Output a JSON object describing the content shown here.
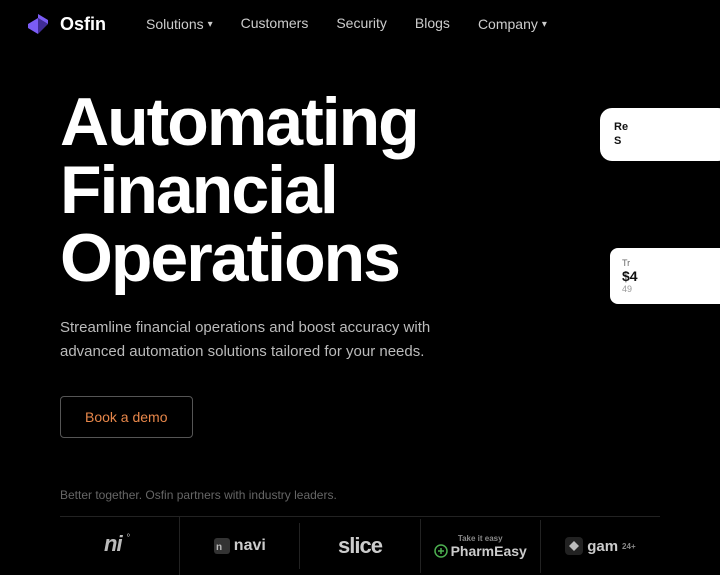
{
  "navbar": {
    "logo_text": "Osfin",
    "nav_items": [
      {
        "label": "Solutions",
        "has_dropdown": true
      },
      {
        "label": "Customers",
        "has_dropdown": false
      },
      {
        "label": "Security",
        "has_dropdown": false
      },
      {
        "label": "Blogs",
        "has_dropdown": false
      },
      {
        "label": "Company",
        "has_dropdown": true
      }
    ]
  },
  "hero": {
    "title_line1": "Automating",
    "title_line2": "Financial",
    "title_line3": "Operations",
    "subtitle": "Streamline financial operations and boost accuracy with advanced automation solutions tailored for your needs.",
    "cta_label": "Book a demo"
  },
  "partners": {
    "label": "Better together. Osfin partners with industry leaders.",
    "logos": [
      {
        "name": "ni",
        "display": "ni°"
      },
      {
        "name": "navi",
        "display": "navi"
      },
      {
        "name": "slice",
        "display": "slice"
      },
      {
        "name": "pharmeasy",
        "display": "PharmEasy",
        "tag": "Take it easy"
      },
      {
        "name": "gamesk",
        "display": "gam"
      }
    ]
  },
  "card_overlay": {
    "title": "Re\nS"
  },
  "card_mini": {
    "label": "Tr",
    "amount": "$4",
    "sub": "49"
  }
}
